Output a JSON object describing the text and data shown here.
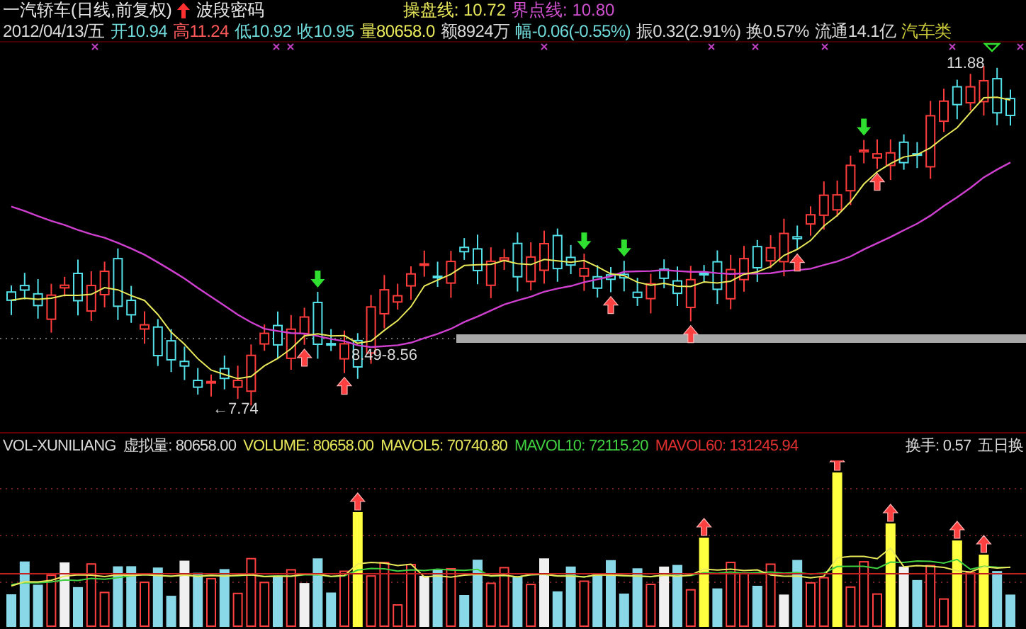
{
  "header": {
    "title": "一汽轿车(日线,前复权)",
    "indicator": "波段密码",
    "lines": [
      {
        "text": "操盘线: 10.72",
        "color": "#e8e85a"
      },
      {
        "text": "界点线: 10.80",
        "color": "#d050d0"
      }
    ]
  },
  "quote": [
    {
      "text": "2012/04/13/五",
      "color": "#d8d8d8"
    },
    {
      "text": "开10.94",
      "color": "#6fd8d8"
    },
    {
      "text": "高11.24",
      "color": "#ff5a5a"
    },
    {
      "text": "低10.92",
      "color": "#6fd8d8"
    },
    {
      "text": "收10.95",
      "color": "#6fd8d8"
    },
    {
      "text": "量80658.0",
      "color": "#e8e85a"
    },
    {
      "text": "额8924万",
      "color": "#d8d8d8"
    },
    {
      "text": "幅-0.06(-0.55%)",
      "color": "#6fd8d8"
    },
    {
      "text": "振0.32(2.91%)",
      "color": "#d8d8d8"
    },
    {
      "text": "换0.57%",
      "color": "#d8d8d8"
    },
    {
      "text": "流通14.1亿",
      "color": "#d8d8d8"
    },
    {
      "text": "汽车类",
      "color": "#c8c83a"
    }
  ],
  "chart_labels": [
    {
      "kind": "range",
      "text": "8.49-8.56"
    },
    {
      "kind": "low",
      "text": "←7.74"
    },
    {
      "kind": "high",
      "text": "11.88"
    }
  ],
  "volume_header": [
    {
      "text": "VOL-XUNILIANG",
      "color": "#d8d8d8"
    },
    {
      "text": "虚拟量: 80658.00",
      "color": "#d8d8d8"
    },
    {
      "text": "VOLUME: 80658.00",
      "color": "#e8e85a"
    },
    {
      "text": "MAVOL5: 70740.80",
      "color": "#e8e85a"
    },
    {
      "text": "MAVOL10: 72115.20",
      "color": "#40d040"
    },
    {
      "text": "MAVOL60: 131245.94",
      "color": "#e03030"
    },
    {
      "text": "换手: 0.57",
      "color": "#d8d8d8"
    },
    {
      "text": "五日换",
      "color": "#d8d8d8"
    }
  ]
}
